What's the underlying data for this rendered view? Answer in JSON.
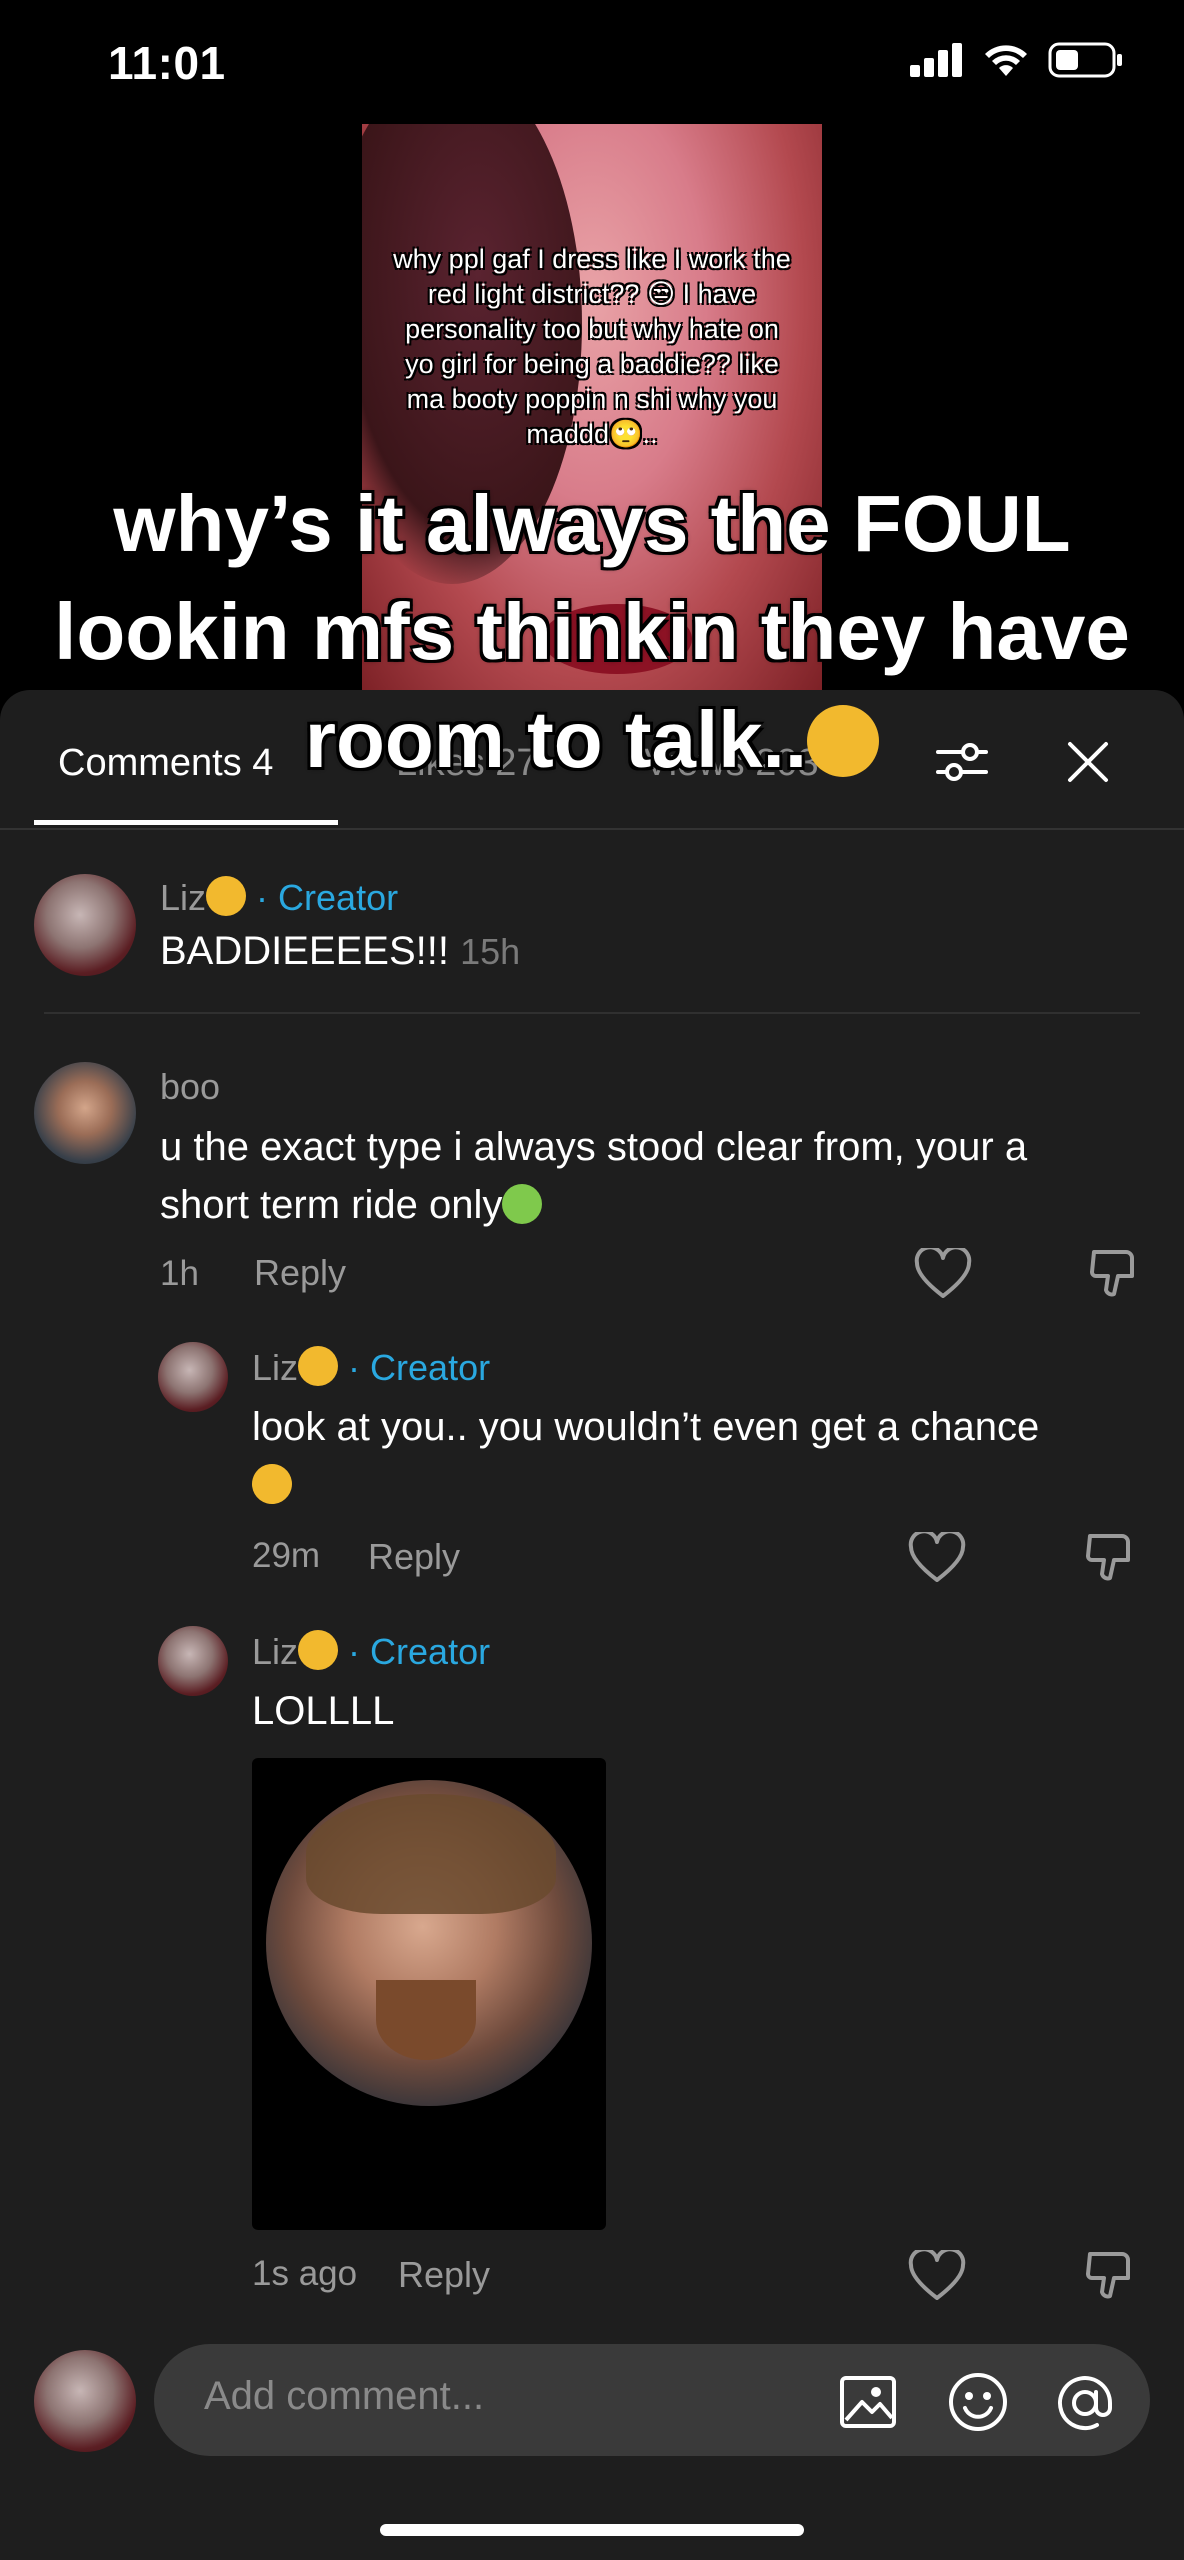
{
  "status": {
    "time": "11:01"
  },
  "video": {
    "caption": "why ppl gaf I dress like I work the red light district?? 😒 I have personality too but why hate on yo girl for being a baddie?? like ma booty poppin n shi why you maddd🙄..",
    "overlay_line1": "why’s it always the FOUL",
    "overlay_line2": "lookin mfs thinkin they have",
    "overlay_line3": "room to talk..",
    "overlay_emoji": "😭"
  },
  "tabs": {
    "comments": "Comments 4",
    "likes": "Likes 27",
    "views": "Views 203"
  },
  "comments": [
    {
      "user": "Liz",
      "user_emoji": "🥴",
      "badge": "· Creator",
      "text": "BADDIEEEES!!!",
      "time": "15h"
    },
    {
      "user": "boo",
      "text_line1": "u the exact type i always stood clear from, your a",
      "text_line2": "short term ride only",
      "text_emoji": "🤢",
      "time": "1h",
      "reply": "Reply"
    }
  ],
  "replies": [
    {
      "user": "Liz",
      "user_emoji": "🥴",
      "badge": "· Creator",
      "text_line1": "look at you.. you wouldn’t even get a chance",
      "text_emoji": "🤣",
      "time": "29m",
      "reply": "Reply"
    },
    {
      "user": "Liz",
      "user_emoji": "🥴",
      "badge": "· Creator",
      "text": "LOLLLL",
      "time": "1s ago",
      "reply": "Reply"
    }
  ],
  "input": {
    "placeholder": "Add comment..."
  }
}
